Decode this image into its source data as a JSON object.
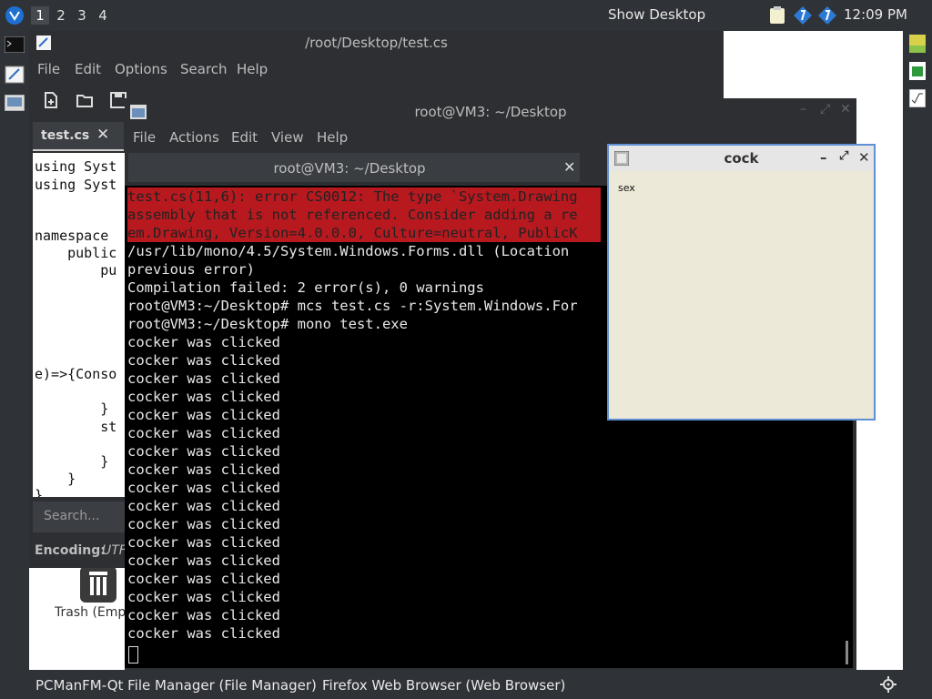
{
  "panel": {
    "workspaces": [
      "1",
      "2",
      "3",
      "4"
    ],
    "active_workspace": "1",
    "show_desktop": "Show Desktop",
    "clock": "12:09 PM"
  },
  "desktop": {
    "trash_label": "Trash (Emp"
  },
  "editor": {
    "title": "/root/Desktop/test.cs",
    "menu": [
      "File",
      "Edit",
      "Options",
      "Search",
      "Help"
    ],
    "tab_label": "test.cs",
    "code_lines": [
      "using Syst",
      "using Syst",
      "",
      "",
      "namespace",
      "    public",
      "        pu",
      "",
      "",
      "",
      "",
      "e)=>{Conso",
      "",
      "        }",
      "        st",
      "",
      "        }",
      "    }",
      "}"
    ],
    "search_placeholder": "Search...",
    "encoding_label": "Encoding:",
    "encoding_value": "UTF"
  },
  "terminal": {
    "title": "root@VM3: ~/Desktop",
    "menu": [
      "File",
      "Actions",
      "Edit",
      "View",
      "Help"
    ],
    "tab_title": "root@VM3: ~/Desktop",
    "error_lines": [
      "test.cs(11,6): error CS0012: The type `System.Drawing",
      "assembly that is not referenced. Consider adding a re",
      "em.Drawing, Version=4.0.0.0, Culture=neutral, PublicK"
    ],
    "lines": [
      "/usr/lib/mono/4.5/System.Windows.Forms.dll (Location",
      "previous error)",
      "Compilation failed: 2 error(s), 0 warnings",
      "root@VM3:~/Desktop# mcs test.cs -r:System.Windows.For",
      "root@VM3:~/Desktop# mono test.exe",
      "cocker was clicked",
      "cocker was clicked",
      "cocker was clicked",
      "cocker was clicked",
      "cocker was clicked",
      "cocker was clicked",
      "cocker was clicked",
      "cocker was clicked",
      "cocker was clicked",
      "cocker was clicked",
      "cocker was clicked",
      "cocker was clicked",
      "cocker was clicked",
      "cocker was clicked",
      "cocker was clicked",
      "cocker was clicked",
      "cocker was clicked"
    ]
  },
  "form_window": {
    "title": "cock",
    "label": "sex"
  },
  "taskbar": {
    "items": [
      "PCManFM-Qt File Manager (File Manager)",
      "Firefox Web Browser (Web Browser)"
    ]
  },
  "colors": {
    "panel_bg": "#2f3236",
    "error_bg": "#b7191f",
    "form_border": "#5f8fd4",
    "form_bg": "#ece9d8"
  }
}
